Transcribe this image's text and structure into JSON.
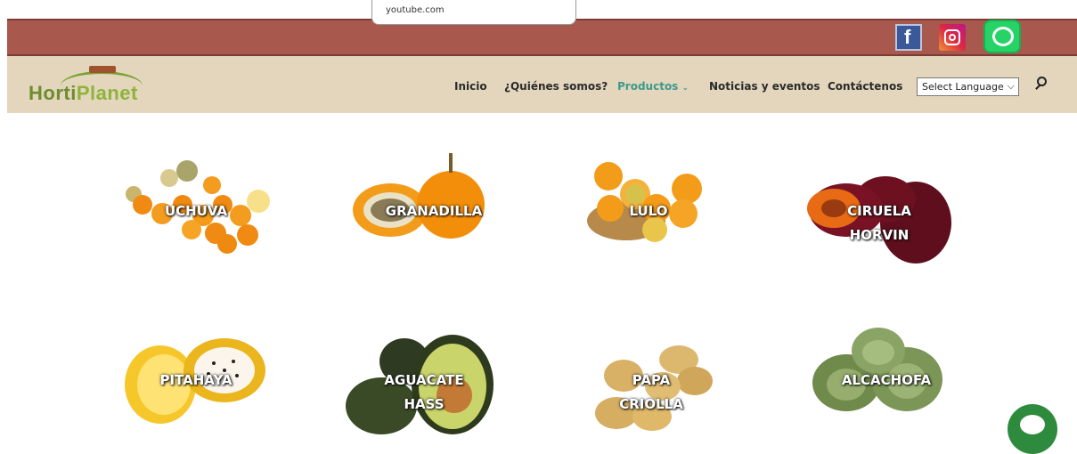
{
  "tooltip": {
    "text": "youtube.com"
  },
  "social": {
    "facebook": "facebook-icon",
    "instagram": "instagram-icon",
    "whatsapp": "whatsapp-icon"
  },
  "logo": {
    "part1": "Horti",
    "part2": "Planet"
  },
  "nav": {
    "inicio": "Inicio",
    "quienes": "¿Quiénes somos?",
    "productos": "Productos",
    "noticias": "Noticias y eventos",
    "contactenos": "Contáctenos"
  },
  "language_select": {
    "value": "Select Language"
  },
  "products": [
    {
      "line1": "UCHUVA",
      "line2": ""
    },
    {
      "line1": "GRANADILLA",
      "line2": ""
    },
    {
      "line1": "LULO",
      "line2": ""
    },
    {
      "line1": "CIRUELA",
      "line2": "HORVIN"
    },
    {
      "line1": "PITAHAYA",
      "line2": ""
    },
    {
      "line1": "AGUACATE",
      "line2": "HASS"
    },
    {
      "line1": "PAPA",
      "line2": "CRIOLLA"
    },
    {
      "line1": "ALCACHOFA",
      "line2": ""
    }
  ],
  "colors": {
    "top_bar": "#a9584d",
    "nav_bar": "#e3d6bd",
    "active_nav": "#3c9a8a",
    "logo_green": "#6c8c2d"
  }
}
